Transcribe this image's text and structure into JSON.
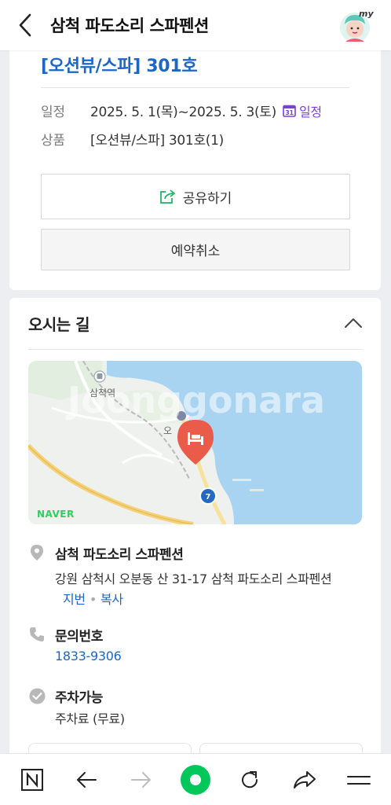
{
  "header": {
    "title": "삼척 파도소리 스파펜션",
    "my_label": "my"
  },
  "booking": {
    "room_title": "[오션뷰/스파] 301호",
    "date_label": "일정",
    "date_value": "2025. 5. 1(목)~2025. 5. 3(토)",
    "calendar_link": "일정",
    "calendar_icon_num": "31",
    "product_label": "상품",
    "product_value": "[오션뷰/스파] 301호(1)",
    "share_button": "공유하기",
    "cancel_button": "예약취소"
  },
  "directions": {
    "title": "오시는 길",
    "map": {
      "brand": "NAVER",
      "station_label": "삼척역",
      "place_label": "오",
      "road_badge": "7",
      "watermark": "Joonggonara"
    },
    "place_name": "삼척 파도소리 스파펜션",
    "address": "강원 삼척시 오분동 산 31-17 삼척 파도소리 스파펜션",
    "jibun_link": "지번",
    "copy_link": "복사",
    "phone_label": "문의번호",
    "phone_number": "1833-9306",
    "parking_label": "주차가능",
    "parking_value": "주차료 (무료)"
  },
  "colors": {
    "accent_blue": "#1b67c6",
    "naver_green": "#03c75a",
    "calendar_purple": "#7b3fd9",
    "map_sea": "#a8d3f1",
    "pin_red": "#ea5b4a"
  },
  "navbar": {
    "icons": [
      "naver-n-icon",
      "back-arrow-icon",
      "forward-arrow-icon",
      "home-green-icon",
      "refresh-icon",
      "share-arrow-icon",
      "menu-icon"
    ]
  }
}
